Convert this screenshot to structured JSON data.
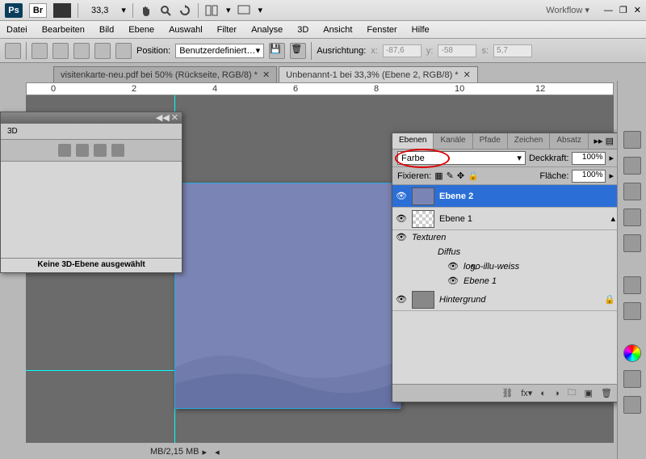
{
  "app": {
    "zoom": "33,3",
    "workspace": "Workflow ▾"
  },
  "menu": [
    "Datei",
    "Bearbeiten",
    "Bild",
    "Ebene",
    "Auswahl",
    "Filter",
    "Analyse",
    "3D",
    "Ansicht",
    "Fenster",
    "Hilfe"
  ],
  "options": {
    "position_label": "Position:",
    "position_value": "Benutzerdefiniert…",
    "align_label": "Ausrichtung:",
    "x_label": "x:",
    "x": "-87,6",
    "y_label": "y:",
    "y": "-58",
    "s_label": "s:",
    "s": "5,7"
  },
  "docTabs": [
    {
      "title": "visitenkarte-neu.pdf bei 50% (Rückseite, RGB/8) *"
    },
    {
      "title": "Unbenannt-1 bei 33,3% (Ebene 2, RGB/8) *"
    }
  ],
  "ruler_marks": [
    "0",
    "2",
    "4",
    "6",
    "8",
    "10",
    "12"
  ],
  "panel3d": {
    "title": "3D",
    "footer": "Keine 3D-Ebene ausgewählt"
  },
  "layers": {
    "tabs": [
      "Ebenen",
      "Kanäle",
      "Pfade",
      "Zeichen",
      "Absatz"
    ],
    "blend": "Farbe",
    "opacity_label": "Deckkraft:",
    "opacity": "100%",
    "lock_label": "Fixieren:",
    "fill_label": "Fläche:",
    "fill": "100%",
    "items": [
      {
        "name": "Ebene 2",
        "selected": true,
        "thumb": "#7b85b5"
      },
      {
        "name": "Ebene 1",
        "thumb": "checker"
      },
      {
        "name": "Hintergrund",
        "thumb": "#888",
        "locked": true,
        "italic": true
      }
    ],
    "textures_label": "Texturen",
    "diffuse_label": "Diffus",
    "children": [
      "logo-illu-weiss",
      "Ebene 1"
    ],
    "footer_icons": [
      "link",
      "fx",
      "mask",
      "adj",
      "group",
      "new",
      "trash"
    ]
  },
  "status": {
    "mb": "MB/2,15 MB"
  }
}
